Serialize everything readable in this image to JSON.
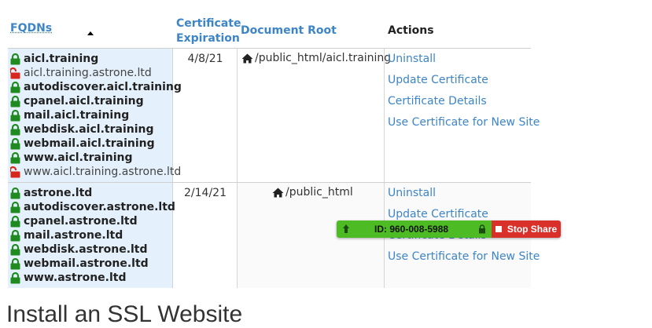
{
  "table": {
    "headers": {
      "fqdns": "FQDNs",
      "expiration_line1": "Certificate",
      "expiration_line2": "Expiration",
      "document_root": "Document Root",
      "actions": "Actions"
    },
    "rows": [
      {
        "fqdns": [
          {
            "name": "aicl.training",
            "secure": true
          },
          {
            "name": "aicl.training.astrone.ltd",
            "secure": false
          },
          {
            "name": "autodiscover.aicl.training",
            "secure": true
          },
          {
            "name": "cpanel.aicl.training",
            "secure": true
          },
          {
            "name": "mail.aicl.training",
            "secure": true
          },
          {
            "name": "webdisk.aicl.training",
            "secure": true
          },
          {
            "name": "webmail.aicl.training",
            "secure": true
          },
          {
            "name": "www.aicl.training",
            "secure": true
          },
          {
            "name": "www.aicl.training.astrone.ltd",
            "secure": false
          }
        ],
        "expiration": "4/8/21",
        "document_root": "/public_html/aicl.training",
        "actions": [
          "Uninstall",
          "Update Certificate",
          "Certificate Details",
          "Use Certificate for New Site"
        ]
      },
      {
        "fqdns": [
          {
            "name": "astrone.ltd",
            "secure": true
          },
          {
            "name": "autodiscover.astrone.ltd",
            "secure": true
          },
          {
            "name": "cpanel.astrone.ltd",
            "secure": true
          },
          {
            "name": "mail.astrone.ltd",
            "secure": true
          },
          {
            "name": "webdisk.astrone.ltd",
            "secure": true
          },
          {
            "name": "webmail.astrone.ltd",
            "secure": true
          },
          {
            "name": "www.astrone.ltd",
            "secure": true
          }
        ],
        "expiration": "2/14/21",
        "document_root": "/public_html",
        "actions": [
          "Uninstall",
          "Update Certificate",
          "Certificate Details",
          "Use Certificate for New Site"
        ]
      }
    ]
  },
  "share_bar": {
    "id_text": "ID: 960-008-5988",
    "stop_label": "Stop Share"
  },
  "section_heading_partial": "Install an SSL Website",
  "colors": {
    "link": "#3d85c6",
    "secure_lock": "#1f8a1f",
    "insecure_lock": "#d7261b",
    "fqdn_bg": "#e4f1fc",
    "share_green": "#4dbb24",
    "share_red": "#d9302a"
  },
  "icons": {
    "secure": "lock-closed-icon",
    "insecure": "lock-open-icon",
    "document_root": "home-icon"
  }
}
